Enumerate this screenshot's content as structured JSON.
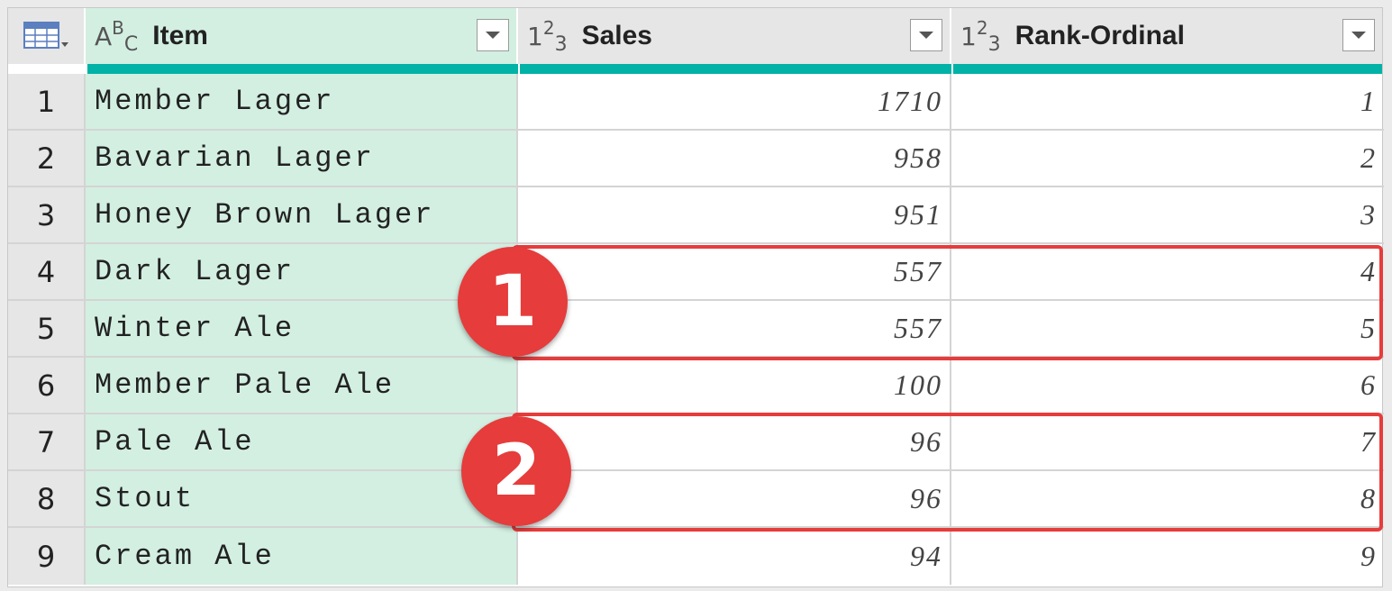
{
  "columns": [
    {
      "label": "Item",
      "type_icon": "ABC"
    },
    {
      "label": "Sales",
      "type_icon": "123"
    },
    {
      "label": "Rank-Ordinal",
      "type_icon": "123"
    }
  ],
  "rows": [
    {
      "num": "1",
      "item": "Member Lager",
      "sales": "1710",
      "rank": "1"
    },
    {
      "num": "2",
      "item": "Bavarian Lager",
      "sales": "958",
      "rank": "2"
    },
    {
      "num": "3",
      "item": "Honey Brown Lager",
      "sales": "951",
      "rank": "3"
    },
    {
      "num": "4",
      "item": "Dark Lager",
      "sales": "557",
      "rank": "4"
    },
    {
      "num": "5",
      "item": "Winter Ale",
      "sales": "557",
      "rank": "5"
    },
    {
      "num": "6",
      "item": "Member Pale Ale",
      "sales": "100",
      "rank": "6"
    },
    {
      "num": "7",
      "item": "Pale Ale",
      "sales": "96",
      "rank": "7"
    },
    {
      "num": "8",
      "item": "Stout",
      "sales": "96",
      "rank": "8"
    },
    {
      "num": "9",
      "item": "Cream Ale",
      "sales": "94",
      "rank": "9"
    }
  ],
  "badges": [
    "1",
    "2"
  ],
  "colors": {
    "accent": "#e63c3c",
    "quality_bar": "#00b3a6",
    "text_column_bg": "#d3efe2"
  }
}
